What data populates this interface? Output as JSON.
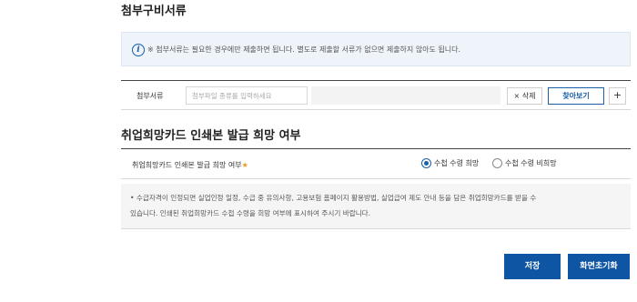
{
  "attachments": {
    "section_title": "첨부구비서류",
    "notice_icon": "info-icon",
    "notice_text": "※  첨부서류는 필요한 경우에만 제출하면 됩니다. 별도로 제출할 서류가 없으면 제출하지 않아도 됩니다.",
    "row_label": "첨부서류",
    "input_placeholder": "첨부파일 종류를 입력하세요",
    "delete_label": "× 삭제",
    "find_label": "찾아보기",
    "add_label": "+"
  },
  "card": {
    "section_title": "취업희망카드 인쇄본 발급 희망 여부",
    "row_label": "취업희망카드 인쇄본 발급 희망 여부",
    "required_mark": "★",
    "options": [
      {
        "label": "수첩 수령 희망",
        "selected": true
      },
      {
        "label": "수첩 수령 비희망",
        "selected": false
      }
    ],
    "note_line1": "•  수급자격이 인정되면 실업인정 일정, 수급 중 유의사항, 고용보험 홈페이지 활용방법, 실업급여 제도 안내 등을 담은 취업희망카드를 받을 수",
    "note_line2": "있습니다. 인쇄된 취업희망카드 수첩 수령을 희망 여부에 표시하여 주시기 바랍니다."
  },
  "actions": {
    "save_label": "저장",
    "reset_label": "화면초기화"
  },
  "colors": {
    "primary": "#0e55a4",
    "notice_bg": "#eef4fa",
    "required": "#e69a20"
  }
}
